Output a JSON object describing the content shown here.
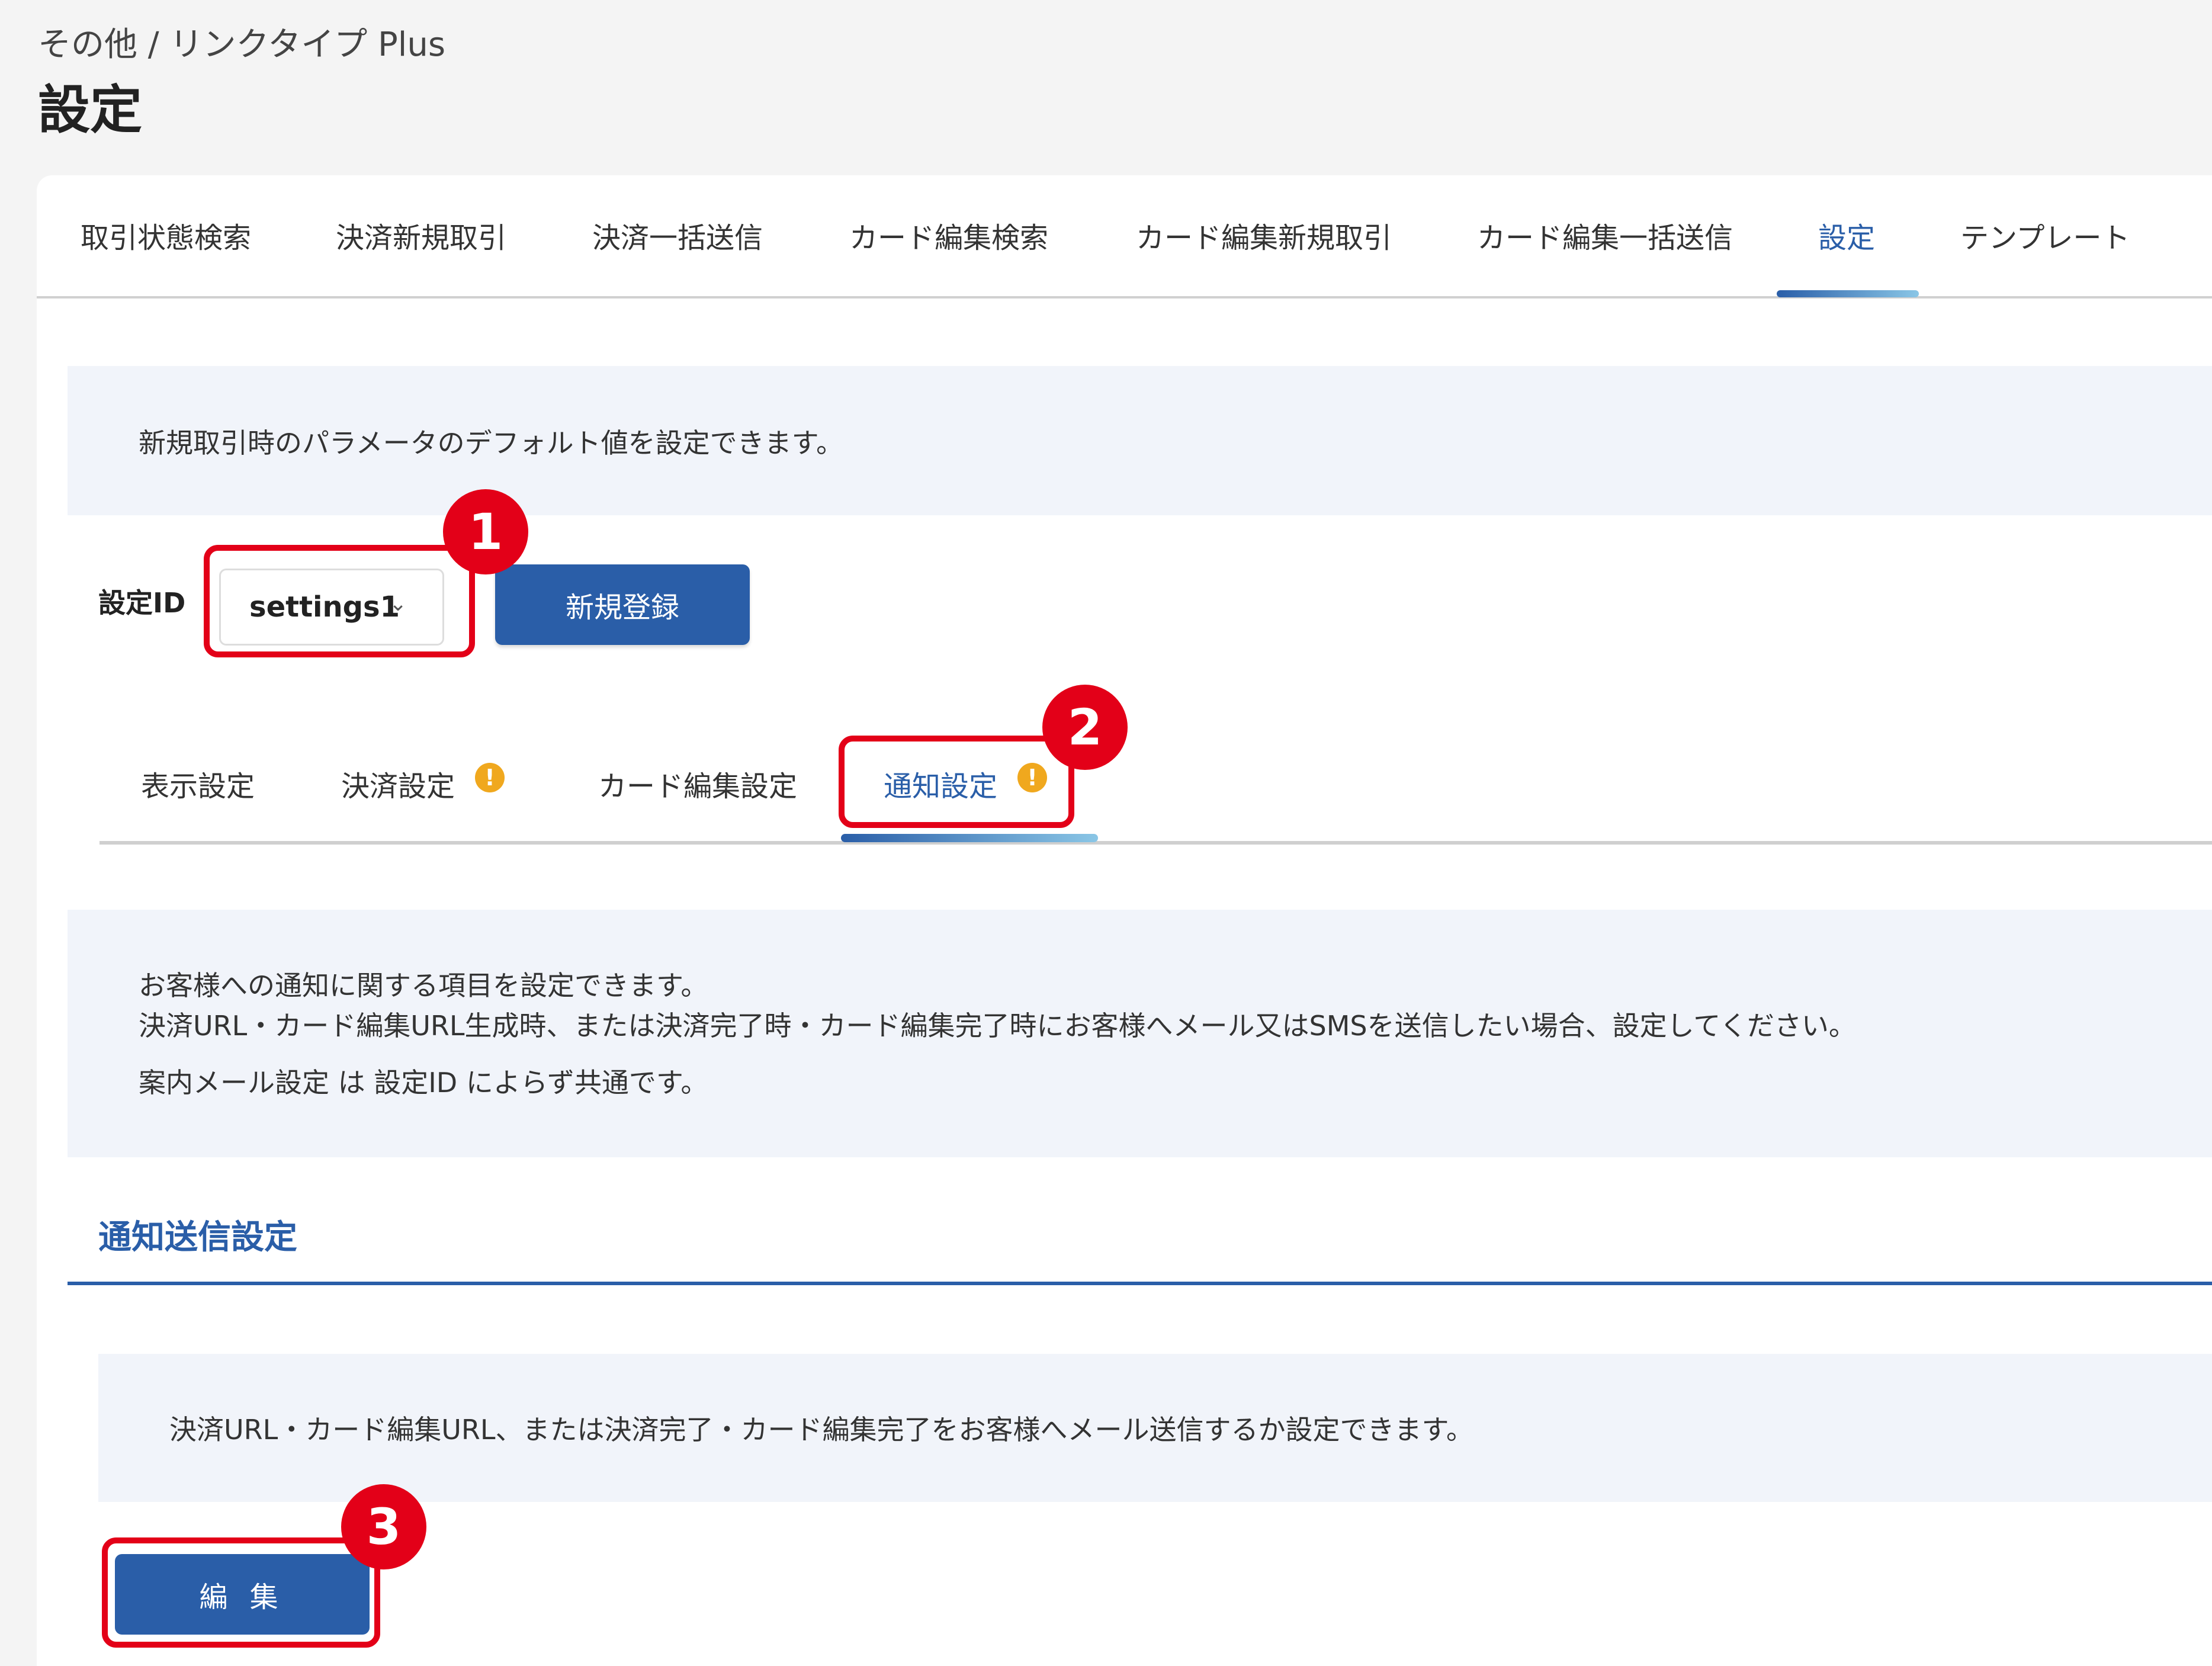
{
  "header": {
    "breadcrumb": "その他 / リンクタイプ Plus",
    "title": "設定"
  },
  "top_tabs": [
    {
      "label": "取引状態検索",
      "active": false
    },
    {
      "label": "決済新規取引",
      "active": false
    },
    {
      "label": "決済一括送信",
      "active": false
    },
    {
      "label": "カード編集検索",
      "active": false
    },
    {
      "label": "カード編集新規取引",
      "active": false
    },
    {
      "label": "カード編集一括送信",
      "active": false
    },
    {
      "label": "設定",
      "active": true
    },
    {
      "label": "テンプレート",
      "active": false
    }
  ],
  "info_default": "新規取引時のパラメータのデフォルト値を設定できます。",
  "settings_id": {
    "label": "設定ID",
    "selected": "settings1",
    "new_button": "新規登録"
  },
  "sub_tabs": [
    {
      "label": "表示設定",
      "warning": false,
      "active": false
    },
    {
      "label": "決済設定",
      "warning": true,
      "active": false
    },
    {
      "label": "カード編集設定",
      "warning": false,
      "active": false
    },
    {
      "label": "通知設定",
      "warning": true,
      "active": true
    }
  ],
  "notification_info": [
    "お客様への通知に関する項目を設定できます。",
    "決済URL・カード編集URL生成時、または決済完了時・カード編集完了時にお客様へメール又はSMSを送信したい場合、設定してください。",
    "案内メール設定 は 設定ID によらず共通です。"
  ],
  "section": {
    "title": "通知送信設定",
    "description": "決済URL・カード編集URL、または決済完了・カード編集完了をお客様へメール送信するか設定できます。",
    "edit_button": "編 集"
  },
  "callouts": [
    "1",
    "2",
    "3"
  ],
  "icons": {
    "warning": "!",
    "chevron": "⌄"
  },
  "colors": {
    "accent": "#2a5ea8",
    "callout": "#e30018",
    "warning": "#f0a81e",
    "info_bg": "#f1f4fa"
  }
}
